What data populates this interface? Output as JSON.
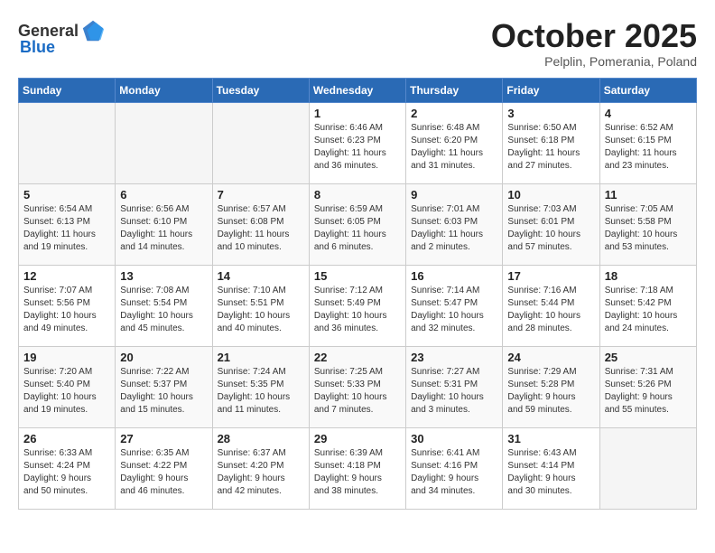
{
  "header": {
    "logo_general": "General",
    "logo_blue": "Blue",
    "month": "October 2025",
    "location": "Pelplin, Pomerania, Poland"
  },
  "days_of_week": [
    "Sunday",
    "Monday",
    "Tuesday",
    "Wednesday",
    "Thursday",
    "Friday",
    "Saturday"
  ],
  "weeks": [
    [
      {
        "day": "",
        "content": ""
      },
      {
        "day": "",
        "content": ""
      },
      {
        "day": "",
        "content": ""
      },
      {
        "day": "1",
        "content": "Sunrise: 6:46 AM\nSunset: 6:23 PM\nDaylight: 11 hours\nand 36 minutes."
      },
      {
        "day": "2",
        "content": "Sunrise: 6:48 AM\nSunset: 6:20 PM\nDaylight: 11 hours\nand 31 minutes."
      },
      {
        "day": "3",
        "content": "Sunrise: 6:50 AM\nSunset: 6:18 PM\nDaylight: 11 hours\nand 27 minutes."
      },
      {
        "day": "4",
        "content": "Sunrise: 6:52 AM\nSunset: 6:15 PM\nDaylight: 11 hours\nand 23 minutes."
      }
    ],
    [
      {
        "day": "5",
        "content": "Sunrise: 6:54 AM\nSunset: 6:13 PM\nDaylight: 11 hours\nand 19 minutes."
      },
      {
        "day": "6",
        "content": "Sunrise: 6:56 AM\nSunset: 6:10 PM\nDaylight: 11 hours\nand 14 minutes."
      },
      {
        "day": "7",
        "content": "Sunrise: 6:57 AM\nSunset: 6:08 PM\nDaylight: 11 hours\nand 10 minutes."
      },
      {
        "day": "8",
        "content": "Sunrise: 6:59 AM\nSunset: 6:05 PM\nDaylight: 11 hours\nand 6 minutes."
      },
      {
        "day": "9",
        "content": "Sunrise: 7:01 AM\nSunset: 6:03 PM\nDaylight: 11 hours\nand 2 minutes."
      },
      {
        "day": "10",
        "content": "Sunrise: 7:03 AM\nSunset: 6:01 PM\nDaylight: 10 hours\nand 57 minutes."
      },
      {
        "day": "11",
        "content": "Sunrise: 7:05 AM\nSunset: 5:58 PM\nDaylight: 10 hours\nand 53 minutes."
      }
    ],
    [
      {
        "day": "12",
        "content": "Sunrise: 7:07 AM\nSunset: 5:56 PM\nDaylight: 10 hours\nand 49 minutes."
      },
      {
        "day": "13",
        "content": "Sunrise: 7:08 AM\nSunset: 5:54 PM\nDaylight: 10 hours\nand 45 minutes."
      },
      {
        "day": "14",
        "content": "Sunrise: 7:10 AM\nSunset: 5:51 PM\nDaylight: 10 hours\nand 40 minutes."
      },
      {
        "day": "15",
        "content": "Sunrise: 7:12 AM\nSunset: 5:49 PM\nDaylight: 10 hours\nand 36 minutes."
      },
      {
        "day": "16",
        "content": "Sunrise: 7:14 AM\nSunset: 5:47 PM\nDaylight: 10 hours\nand 32 minutes."
      },
      {
        "day": "17",
        "content": "Sunrise: 7:16 AM\nSunset: 5:44 PM\nDaylight: 10 hours\nand 28 minutes."
      },
      {
        "day": "18",
        "content": "Sunrise: 7:18 AM\nSunset: 5:42 PM\nDaylight: 10 hours\nand 24 minutes."
      }
    ],
    [
      {
        "day": "19",
        "content": "Sunrise: 7:20 AM\nSunset: 5:40 PM\nDaylight: 10 hours\nand 19 minutes."
      },
      {
        "day": "20",
        "content": "Sunrise: 7:22 AM\nSunset: 5:37 PM\nDaylight: 10 hours\nand 15 minutes."
      },
      {
        "day": "21",
        "content": "Sunrise: 7:24 AM\nSunset: 5:35 PM\nDaylight: 10 hours\nand 11 minutes."
      },
      {
        "day": "22",
        "content": "Sunrise: 7:25 AM\nSunset: 5:33 PM\nDaylight: 10 hours\nand 7 minutes."
      },
      {
        "day": "23",
        "content": "Sunrise: 7:27 AM\nSunset: 5:31 PM\nDaylight: 10 hours\nand 3 minutes."
      },
      {
        "day": "24",
        "content": "Sunrise: 7:29 AM\nSunset: 5:28 PM\nDaylight: 9 hours\nand 59 minutes."
      },
      {
        "day": "25",
        "content": "Sunrise: 7:31 AM\nSunset: 5:26 PM\nDaylight: 9 hours\nand 55 minutes."
      }
    ],
    [
      {
        "day": "26",
        "content": "Sunrise: 6:33 AM\nSunset: 4:24 PM\nDaylight: 9 hours\nand 50 minutes."
      },
      {
        "day": "27",
        "content": "Sunrise: 6:35 AM\nSunset: 4:22 PM\nDaylight: 9 hours\nand 46 minutes."
      },
      {
        "day": "28",
        "content": "Sunrise: 6:37 AM\nSunset: 4:20 PM\nDaylight: 9 hours\nand 42 minutes."
      },
      {
        "day": "29",
        "content": "Sunrise: 6:39 AM\nSunset: 4:18 PM\nDaylight: 9 hours\nand 38 minutes."
      },
      {
        "day": "30",
        "content": "Sunrise: 6:41 AM\nSunset: 4:16 PM\nDaylight: 9 hours\nand 34 minutes."
      },
      {
        "day": "31",
        "content": "Sunrise: 6:43 AM\nSunset: 4:14 PM\nDaylight: 9 hours\nand 30 minutes."
      },
      {
        "day": "",
        "content": ""
      }
    ]
  ]
}
